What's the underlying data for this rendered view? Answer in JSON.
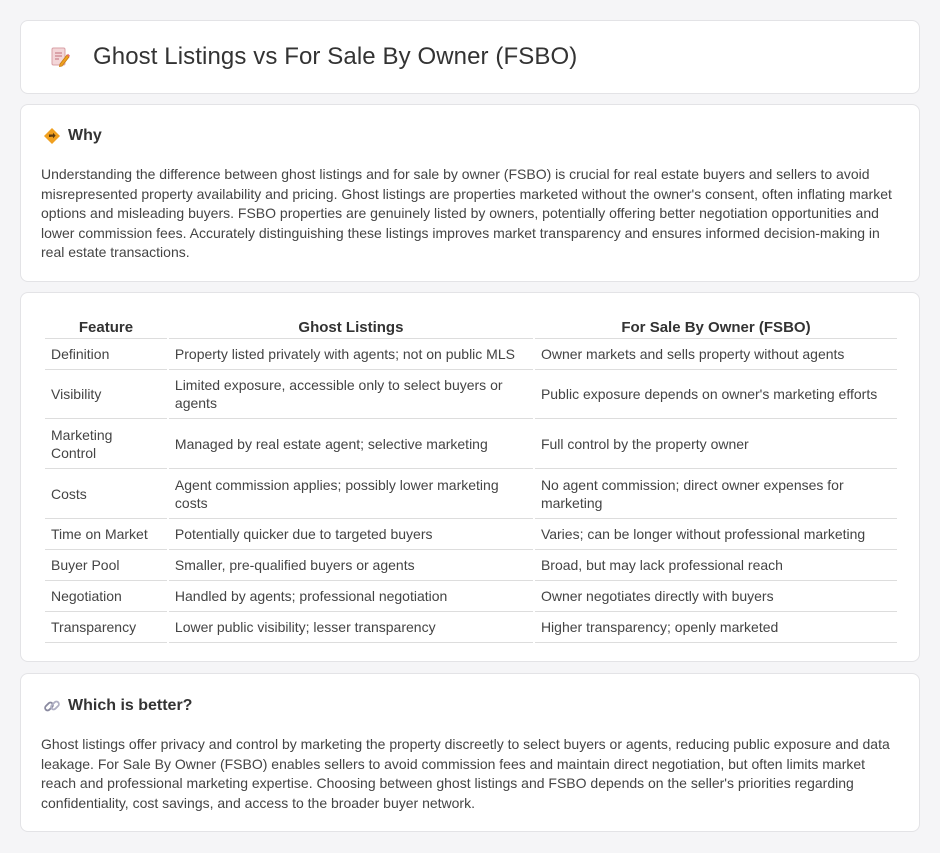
{
  "header": {
    "title": "Ghost Listings vs For Sale By Owner (FSBO)",
    "icon": "document-pencil-icon"
  },
  "why": {
    "heading": "Why",
    "icon": "diamond-direction-icon",
    "body": "Understanding the difference between ghost listings and for sale by owner (FSBO) is crucial for real estate buyers and sellers to avoid misrepresented property availability and pricing. Ghost listings are properties marketed without the owner's consent, often inflating market options and misleading buyers. FSBO properties are genuinely listed by owners, potentially offering better negotiation opportunities and lower commission fees. Accurately distinguishing these listings improves market transparency and ensures informed decision-making in real estate transactions."
  },
  "comparison": {
    "columns": [
      "Feature",
      "Ghost Listings",
      "For Sale By Owner (FSBO)"
    ],
    "rows": [
      [
        "Definition",
        "Property listed privately with agents; not on public MLS",
        "Owner markets and sells property without agents"
      ],
      [
        "Visibility",
        "Limited exposure, accessible only to select buyers or agents",
        "Public exposure depends on owner's marketing efforts"
      ],
      [
        "Marketing Control",
        "Managed by real estate agent; selective marketing",
        "Full control by the property owner"
      ],
      [
        "Costs",
        "Agent commission applies; possibly lower marketing costs",
        "No agent commission; direct owner expenses for marketing"
      ],
      [
        "Time on Market",
        "Potentially quicker due to targeted buyers",
        "Varies; can be longer without professional marketing"
      ],
      [
        "Buyer Pool",
        "Smaller, pre-qualified buyers or agents",
        "Broad, but may lack professional reach"
      ],
      [
        "Negotiation",
        "Handled by agents; professional negotiation",
        "Owner negotiates directly with buyers"
      ],
      [
        "Transparency",
        "Lower public visibility; lesser transparency",
        "Higher transparency; openly marketed"
      ]
    ]
  },
  "better": {
    "heading": "Which is better?",
    "icon": "link-icon",
    "body": "Ghost listings offer privacy and control by marketing the property discreetly to select buyers or agents, reducing public exposure and data leakage. For Sale By Owner (FSBO) enables sellers to avoid commission fees and maintain direct negotiation, but often limits market reach and professional marketing expertise. Choosing between ghost listings and FSBO depends on the seller's priorities regarding confidentiality, cost savings, and access to the broader buyer network."
  },
  "colors": {
    "background": "#f5f5f7",
    "card": "#ffffff",
    "border": "#e3e3e6",
    "accent_orange": "#f0a020",
    "icon_pink": "#e8707a"
  }
}
